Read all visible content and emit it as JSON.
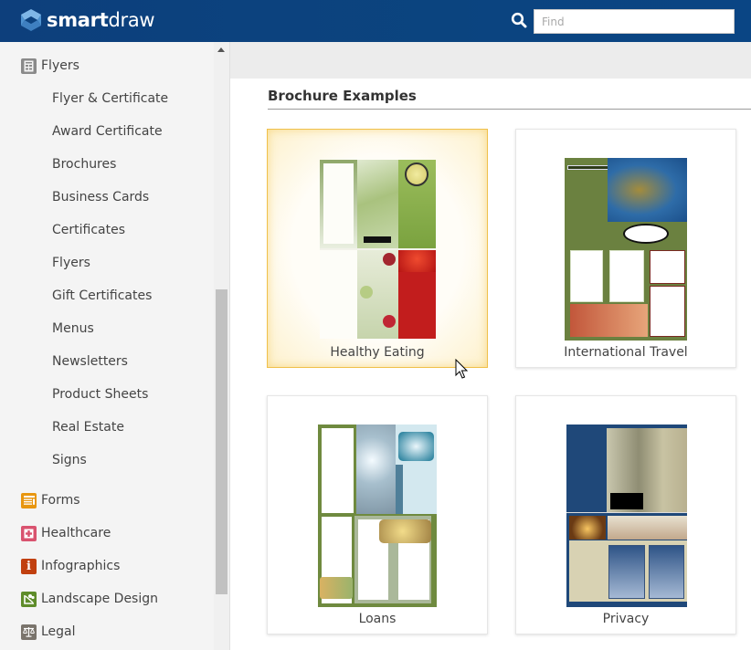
{
  "app": {
    "brand_bold": "smart",
    "brand_light": "draw",
    "search": {
      "placeholder": "Find",
      "value": ""
    }
  },
  "sidebar": {
    "top_category": {
      "label": "Flyers",
      "icon": "flyer-icon",
      "color": "#8a8a8a"
    },
    "subitems": [
      "Flyer & Certificate",
      "Award Certificate",
      "Brochures",
      "Business Cards",
      "Certificates",
      "Flyers",
      "Gift Certificates",
      "Menus",
      "Newsletters",
      "Product Sheets",
      "Real Estate",
      "Signs"
    ],
    "categories": [
      {
        "label": "Forms",
        "icon": "forms-icon",
        "color": "#e8960f"
      },
      {
        "label": "Healthcare",
        "icon": "healthcare-icon",
        "color": "#d9536f"
      },
      {
        "label": "Infographics",
        "icon": "infographics-icon",
        "color": "#c1400f"
      },
      {
        "label": "Landscape Design",
        "icon": "landscape-design-icon",
        "color": "#5e8c2a"
      },
      {
        "label": "Legal",
        "icon": "legal-icon",
        "color": "#7a746c"
      }
    ]
  },
  "main": {
    "section_title": "Brochure Examples",
    "cards": [
      {
        "label": "Healthy Eating",
        "selected": true
      },
      {
        "label": "International Travel",
        "selected": false
      },
      {
        "label": "Loans",
        "selected": false
      },
      {
        "label": "Privacy",
        "selected": false
      }
    ]
  }
}
